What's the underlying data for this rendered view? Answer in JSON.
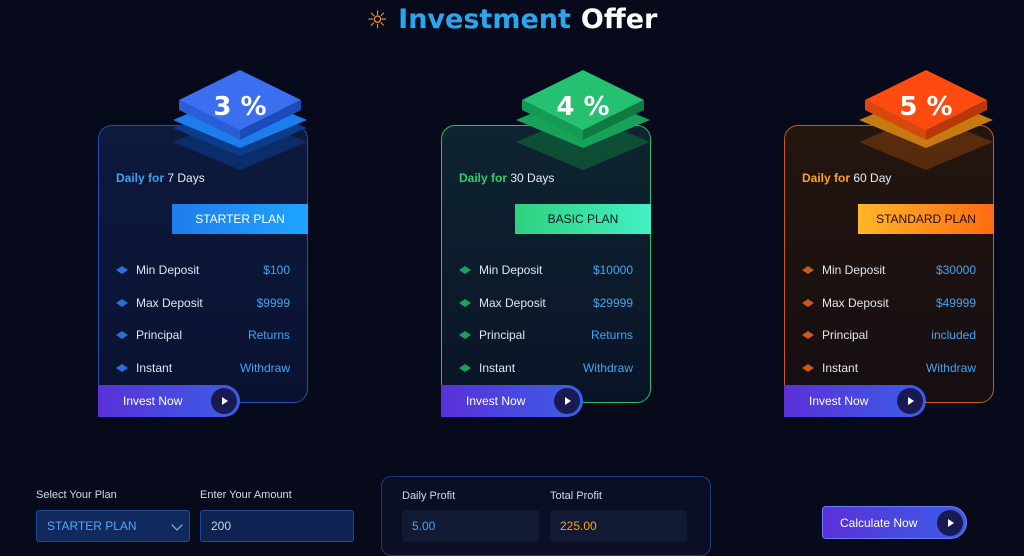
{
  "header": {
    "title_highlight": "Investment",
    "title_rest": "Offer",
    "icon": "sun-icon"
  },
  "plans": [
    {
      "percent": "3 %",
      "daily_label": "Daily for",
      "duration": "7 Days",
      "plan_name": "STARTER PLAN",
      "rows": [
        {
          "key": "Min Deposit",
          "value": "$100"
        },
        {
          "key": "Max Deposit",
          "value": "$9999"
        },
        {
          "key": "Principal",
          "value": "Returns"
        },
        {
          "key": "Instant",
          "value": "Withdraw"
        }
      ],
      "button": "Invest Now",
      "accent": "#1e7dec"
    },
    {
      "percent": "4 %",
      "daily_label": "Daily for",
      "duration": "30 Days",
      "plan_name": "BASIC PLAN",
      "rows": [
        {
          "key": "Min Deposit",
          "value": "$10000"
        },
        {
          "key": "Max Deposit",
          "value": "$29999"
        },
        {
          "key": "Principal",
          "value": "Returns"
        },
        {
          "key": "Instant",
          "value": "Withdraw"
        }
      ],
      "button": "Invest Now",
      "accent": "#2fcf6a"
    },
    {
      "percent": "5 %",
      "daily_label": "Daily for",
      "duration": "60 Day",
      "plan_name": "STANDARD PLAN",
      "rows": [
        {
          "key": "Min Deposit",
          "value": "$30000"
        },
        {
          "key": "Max Deposit",
          "value": "$49999"
        },
        {
          "key": "Principal",
          "value": "included"
        },
        {
          "key": "Instant",
          "value": "Withdraw"
        }
      ],
      "button": "Invest Now",
      "accent": "#ff6a12"
    }
  ],
  "calculator": {
    "select_label": "Select Your Plan",
    "selected_plan": "STARTER PLAN",
    "amount_label": "Enter Your Amount",
    "amount_value": "200",
    "daily_profit_label": "Daily Profit",
    "daily_profit_value": "5.00",
    "total_profit_label": "Total Profit",
    "total_profit_value": "225.00",
    "button": "Calculate Now"
  }
}
